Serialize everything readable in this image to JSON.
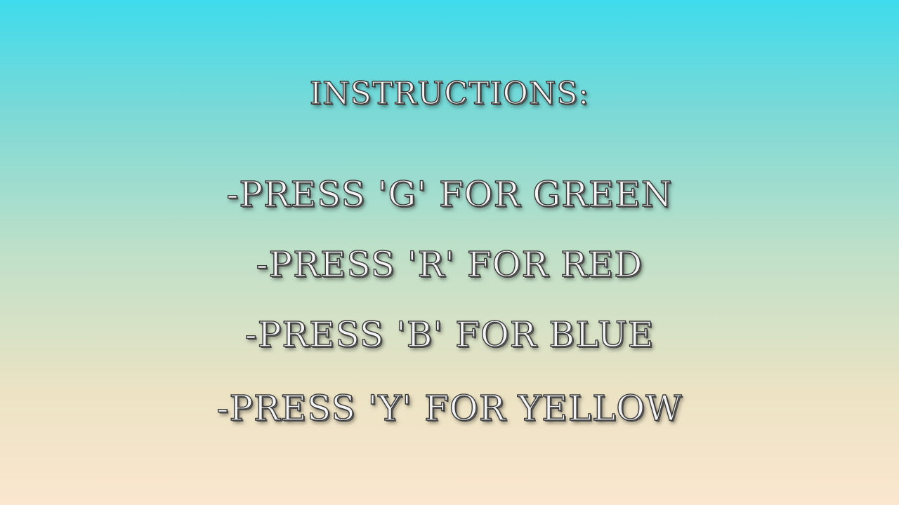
{
  "screen": {
    "title": "INSTRUCTIONS:",
    "instructions": [
      "-PRESS 'G' FOR GREEN",
      "-PRESS 'R' FOR RED",
      "-PRESS 'B' FOR BLUE",
      "-PRESS 'Y' FOR YELLOW"
    ]
  },
  "colors": {
    "background_top": "#3edbec",
    "background_bottom": "#fbe6cf",
    "text_fill": "#f4f4f4",
    "text_outline": "#3a3a3a"
  }
}
